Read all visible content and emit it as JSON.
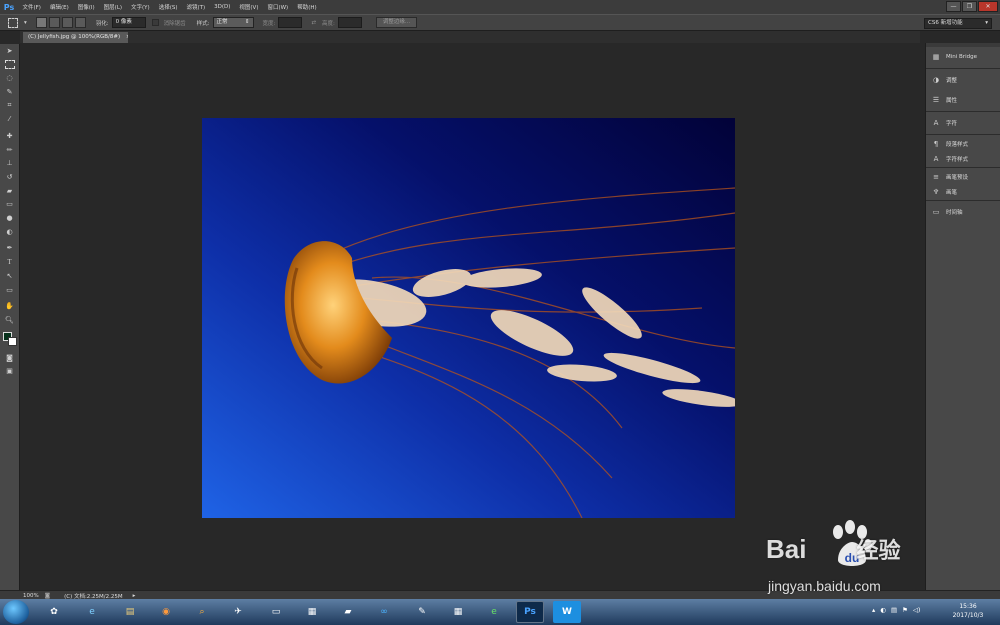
{
  "app": {
    "logo": "Ps"
  },
  "menubar": {
    "items": [
      "文件(F)",
      "编辑(E)",
      "图像(I)",
      "图层(L)",
      "文字(Y)",
      "选择(S)",
      "滤镜(T)",
      "3D(D)",
      "视图(V)",
      "窗口(W)",
      "帮助(H)"
    ]
  },
  "window_controls": {
    "minimize": "—",
    "restore": "❐",
    "close": "✕"
  },
  "options": {
    "feather_label": "羽化:",
    "feather_value": "0 像素",
    "antialias_label": "消除锯齿",
    "style_label": "样式:",
    "style_value": "正常",
    "width_label": "宽度:",
    "height_label": "高度:",
    "refine_button": "调整边缘...",
    "workspace": "CS6 新增功能"
  },
  "document": {
    "tab_title": "(C) Jellyfish.jpg @ 100%(RGB/8#)",
    "tab_close": "×"
  },
  "tools": [
    "move-tool",
    "marquee-tool",
    "lasso-tool",
    "quick-select-tool",
    "crop-tool",
    "eyedropper-tool",
    "heal-tool",
    "brush-tool",
    "stamp-tool",
    "history-brush-tool",
    "eraser-tool",
    "gradient-tool",
    "blur-tool",
    "dodge-tool",
    "pen-tool",
    "type-tool",
    "path-select-tool",
    "shape-tool",
    "hand-tool",
    "zoom-tool"
  ],
  "panels": {
    "items": [
      "Mini Bridge",
      "调整",
      "属性",
      "字符",
      "段落样式",
      "字符样式",
      "画笔预设",
      "画笔",
      "时间轴"
    ]
  },
  "status": {
    "zoom": "100%",
    "doc_info": "(C) 文档:2.25M/2.25M"
  },
  "taskbar": {
    "time": "15:36",
    "date": "2017/10/3"
  },
  "watermark": {
    "main": "Bai",
    "du": "du",
    "cn": "经验",
    "sub": "jingyan.baidu.com"
  },
  "colors": {
    "foreground": "#06321c",
    "background": "#ffffff",
    "image_deep_blue": "#03034a",
    "image_bright_blue": "#1f63e6",
    "jellyfish_orange": "#f0a030"
  }
}
